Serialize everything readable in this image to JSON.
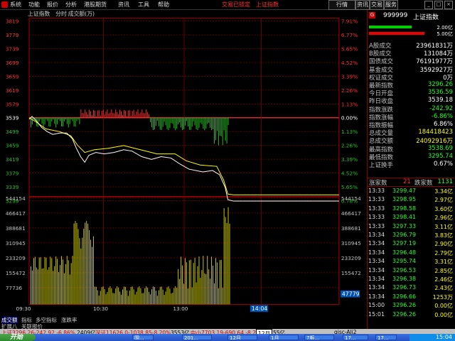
{
  "menu": {
    "items": [
      "系统",
      "功能",
      "报价",
      "分析",
      "港股期货",
      "资讯",
      "工具",
      "帮助"
    ],
    "center": [
      "交易已锁定",
      "上证指数"
    ],
    "right_tabs": [
      "行情",
      "资讯",
      "交易",
      "服务"
    ]
  },
  "chart": {
    "header": [
      "上证指数",
      "分时",
      "成交额(万)"
    ],
    "left_ticks": [
      "3819",
      "3779",
      "3739",
      "3699",
      "3659",
      "3619",
      "3579",
      "3539",
      "3499",
      "3459",
      "3419",
      "3379",
      "3339",
      "3299",
      "544154",
      "466417",
      "388681",
      "310945",
      "233209",
      "155472",
      "77736"
    ],
    "right_ticks": [
      "7.91%",
      "6.77%",
      "5.65%",
      "4.52%",
      "3.39%",
      "2.26%",
      "1.13%",
      "0.00%",
      "1.13%",
      "2.26%",
      "3.39%",
      "4.52%",
      "5.65%",
      "0.78%",
      "544154",
      "466417",
      "388681",
      "310945",
      "233209",
      "155472"
    ],
    "time_ticks": [
      "09:30",
      "10:30",
      "13:00"
    ],
    "cursor_time": "14:04",
    "cursor_value": "47779",
    "base_price": "3539",
    "colors": {
      "up": "#ff3030",
      "down": "#20c020",
      "grid": "#800000",
      "price": "#ffffff",
      "avg": "#ffff00",
      "volume": "#c8c800"
    }
  },
  "panel": {
    "code": "999999",
    "name": "上证指数",
    "badge": "G",
    "bar1": "2.00亿",
    "bar2": "5.00亿",
    "stats": [
      {
        "label": "A股成交",
        "value": "23961831万",
        "color": "#ffffff"
      },
      {
        "label": "B股成交",
        "value": "131084万",
        "color": "#ffffff"
      },
      {
        "label": "国债成交",
        "value": "76191977万",
        "color": "#ffffff"
      },
      {
        "label": "基金成交",
        "value": "3592927万",
        "color": "#ffffff"
      },
      {
        "label": "权证成交",
        "value": "0万",
        "color": "#ffffff"
      },
      {
        "label": "最新指数",
        "value": "3296.26",
        "color": "#20ff20"
      },
      {
        "label": "今日开盘",
        "value": "3536.59",
        "color": "#20ff20"
      },
      {
        "label": "昨日收盘",
        "value": "3539.18",
        "color": "#ffffff"
      },
      {
        "label": "指数涨跌",
        "value": "-242.92",
        "color": "#20ff20"
      },
      {
        "label": "指数涨幅",
        "value": "-6.86%",
        "color": "#20ff20"
      },
      {
        "label": "指数振幅",
        "value": "6.86%",
        "color": "#ffffff"
      },
      {
        "label": "总成交量",
        "value": "184418423",
        "color": "#ffff00"
      },
      {
        "label": "总成交额",
        "value": "24092916万",
        "color": "#ffff00"
      },
      {
        "label": "最高指数",
        "value": "3538.69",
        "color": "#20ff20"
      },
      {
        "label": "最低指数",
        "value": "3295.74",
        "color": "#20ff20"
      },
      {
        "label": "上证换手",
        "value": "0.67%",
        "color": "#ffffff"
      }
    ],
    "updown": {
      "up_label": "涨家数",
      "up_value": "21",
      "down_label": "跌家数",
      "down_value": "1131"
    },
    "ticks": [
      {
        "time": "13:33",
        "price": "3299.47",
        "vol": "3.34亿"
      },
      {
        "time": "13:33",
        "price": "3298.95",
        "vol": "2.97亿"
      },
      {
        "time": "13:33",
        "price": "3298.58",
        "vol": "3.60亿"
      },
      {
        "time": "13:33",
        "price": "3298.41",
        "vol": "2.96亿"
      },
      {
        "time": "13:33",
        "price": "3297.33",
        "vol": "3.11亿"
      },
      {
        "time": "13:34",
        "price": "3296.79",
        "vol": "3.83亿"
      },
      {
        "time": "13:34",
        "price": "3297.19",
        "vol": "2.90亿"
      },
      {
        "time": "13:34",
        "price": "3296.48",
        "vol": "2.79亿"
      },
      {
        "time": "13:34",
        "price": "3295.74",
        "vol": "3.31亿"
      },
      {
        "time": "13:34",
        "price": "3296.53",
        "vol": "2.85亿"
      },
      {
        "time": "13:34",
        "price": "3296.38",
        "vol": "2.46亿"
      },
      {
        "time": "13:34",
        "price": "3296.73",
        "vol": "2.43亿"
      },
      {
        "time": "13:34",
        "price": "3296.66",
        "vol": "1253万"
      },
      {
        "time": "15:00",
        "price": "3296.26",
        "vol": "0.00亿"
      },
      {
        "time": "15:01",
        "price": "3296.26",
        "vol": "0.00亿"
      }
    ]
  },
  "bottom_tabs": [
    "成交额",
    "指标",
    "多空指标",
    "涨跌率"
  ],
  "bottom_row2": [
    "扩展八",
    "关联报价"
  ],
  "ticker": {
    "sh": "上证3296.26-242.92 -6.86%",
    "sh_amt": "2409亿",
    "sz": "深证11626.0-1038.85-8.20%",
    "sz_amt": "3553亿",
    "zx": "中小7703.19-690.64 -8.2",
    "month": "12月",
    "zx_amt": "55亿",
    "info": "gisc-Ali2"
  },
  "taskbar": {
    "start": "开始",
    "items": [
      "国...",
      "201...",
      "12月",
      "1月",
      "7板...",
      "17...",
      "17..."
    ],
    "clock": "15:04"
  }
}
